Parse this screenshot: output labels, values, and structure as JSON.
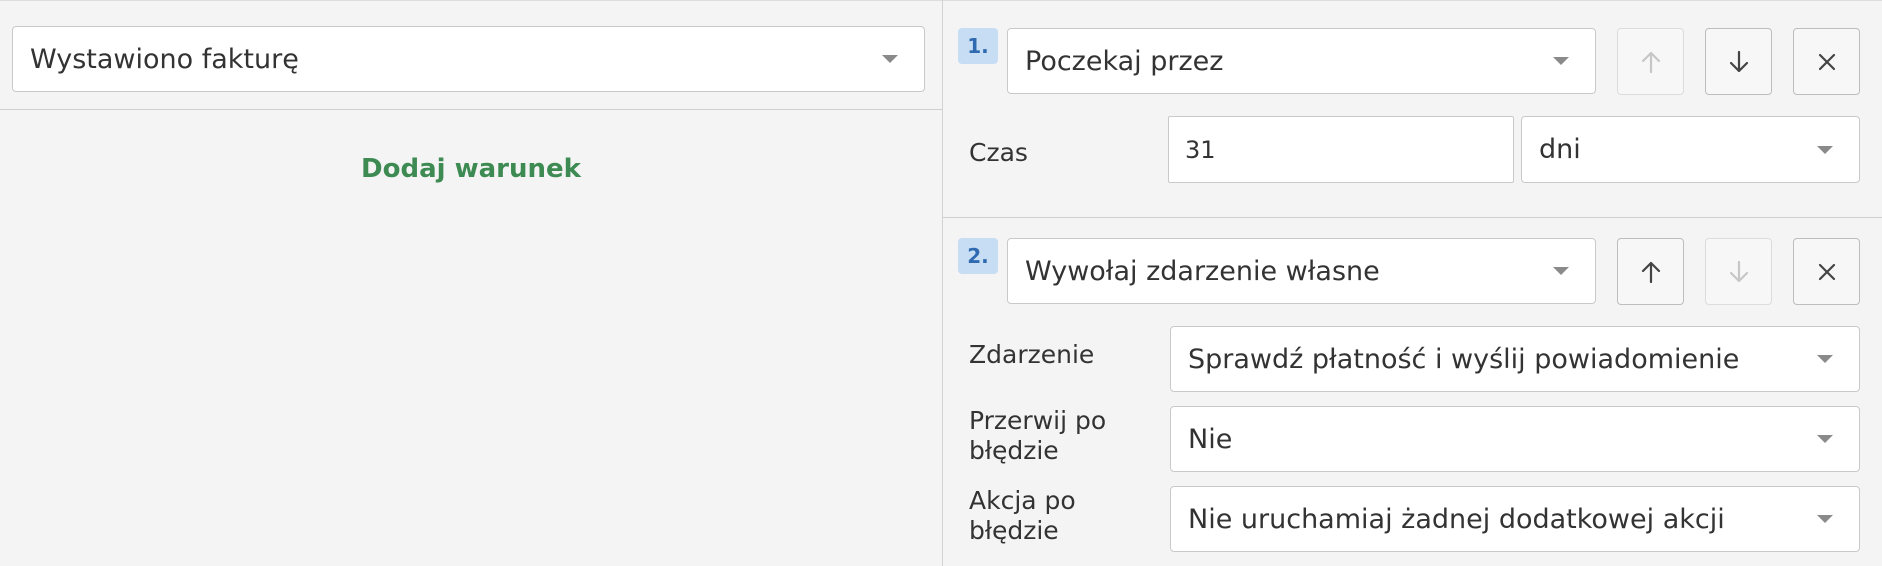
{
  "trigger": {
    "selected": "Wystawiono fakturę",
    "add_condition": "Dodaj warunek"
  },
  "steps": [
    {
      "number": "1.",
      "action": "Poczekaj przez",
      "fields": {
        "time_label": "Czas",
        "time_value": "31",
        "time_unit": "dni"
      },
      "move_up_enabled": false,
      "move_down_enabled": true
    },
    {
      "number": "2.",
      "action": "Wywołaj zdarzenie własne",
      "fields": {
        "event_label": "Zdarzenie",
        "event_value": "Sprawdź płatność i wyślij powiadomienie",
        "stop_label": "Przerwij po błędzie",
        "stop_value": "Nie",
        "on_error_label": "Akcja po błędzie",
        "on_error_value": "Nie uruchamiaj żadnej dodatkowej akcji"
      },
      "move_up_enabled": true,
      "move_down_enabled": false
    }
  ],
  "icons": {
    "move_up": "arrow-up-icon",
    "move_down": "arrow-down-icon",
    "remove": "close-icon",
    "dropdown": "chevron-down-icon"
  },
  "colors": {
    "link_green": "#3d8a52",
    "badge_bg": "#c6ddf3",
    "badge_text": "#2f6ab0",
    "panel_bg": "#f4f4f4"
  }
}
